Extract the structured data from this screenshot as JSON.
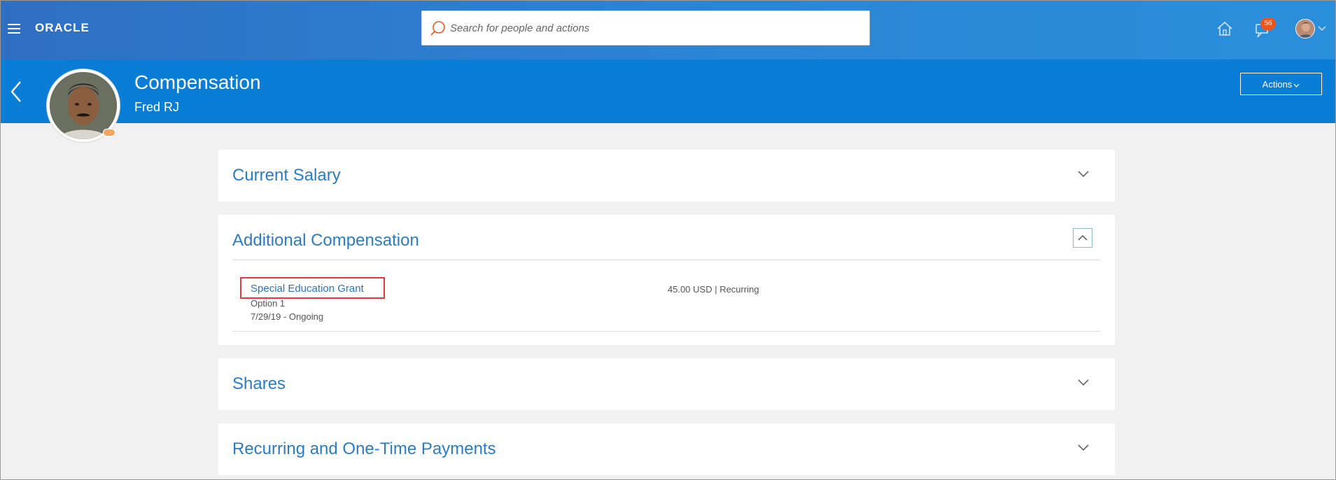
{
  "header": {
    "logo": "ORACLE",
    "search_placeholder": "Search for people and actions",
    "notification_count": "56"
  },
  "page": {
    "title": "Compensation",
    "person_name": "Fred RJ",
    "actions_label": "Actions"
  },
  "sections": {
    "current_salary": {
      "title": "Current Salary",
      "expanded": false
    },
    "additional_compensation": {
      "title": "Additional Compensation",
      "expanded": true,
      "items": [
        {
          "name": "Special Education Grant",
          "option": "Option 1",
          "dates": "7/29/19 - Ongoing",
          "amount": "45.00 USD | Recurring"
        }
      ]
    },
    "shares": {
      "title": "Shares",
      "expanded": false
    },
    "payments": {
      "title": "Recurring and One-Time Payments",
      "expanded": false
    }
  },
  "colors": {
    "header_gradient_start": "#2f6fc3",
    "banner": "#0a7ed6",
    "link": "#2a7cc4",
    "badge": "#f0531c",
    "highlight": "#e03a3a"
  }
}
